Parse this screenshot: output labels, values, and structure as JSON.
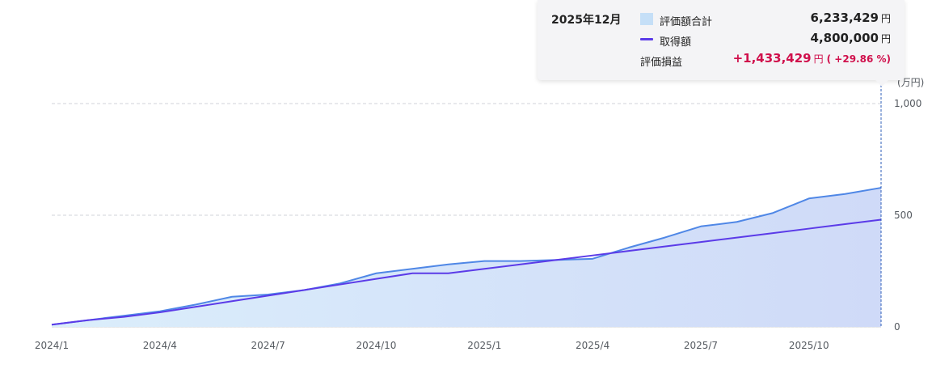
{
  "chart_data": {
    "type": "area",
    "x": [
      "2024/1",
      "2024/2",
      "2024/3",
      "2024/4",
      "2024/5",
      "2024/6",
      "2024/7",
      "2024/8",
      "2024/9",
      "2024/10",
      "2024/11",
      "2024/12",
      "2025/1",
      "2025/2",
      "2025/3",
      "2025/4",
      "2025/5",
      "2025/6",
      "2025/7",
      "2025/8",
      "2025/9",
      "2025/10",
      "2025/11",
      "2025/12"
    ],
    "x_tick_labels": [
      "2024/1",
      "2024/4",
      "2024/7",
      "2024/10",
      "2025/1",
      "2025/4",
      "2025/7",
      "2025/10"
    ],
    "series": [
      {
        "name": "評価額合計",
        "kind": "area",
        "color": "#4f87e6",
        "values": [
          10,
          30,
          50,
          70,
          100,
          135,
          145,
          165,
          195,
          240,
          260,
          280,
          295,
          295,
          300,
          305,
          355,
          400,
          450,
          470,
          510,
          575,
          595,
          623
        ]
      },
      {
        "name": "取得額",
        "kind": "line",
        "color": "#5b3be8",
        "values": [
          10,
          30,
          45,
          65,
          90,
          115,
          140,
          165,
          190,
          215,
          240,
          240,
          260,
          280,
          300,
          320,
          340,
          360,
          380,
          400,
          420,
          440,
          460,
          480
        ]
      }
    ],
    "unit": "(万円)",
    "ylim": [
      0,
      1000
    ],
    "y_ticks": [
      0,
      500,
      1000
    ],
    "y_tick_labels": [
      "0",
      "500",
      "1,000"
    ],
    "grid": true,
    "y_axis_side": "right"
  },
  "tooltip": {
    "month": "2025年12月",
    "rows": [
      {
        "label": "評価額合計",
        "value": "6,233,429",
        "yen": "円",
        "swatch": "fill"
      },
      {
        "label": "取得額",
        "value": "4,800,000",
        "yen": "円",
        "swatch": "line"
      },
      {
        "label": "評価損益",
        "value": "+1,433,429",
        "yen": "円",
        "pct": "( +29.86 %)",
        "swatch": "none"
      }
    ],
    "colors": {
      "positive": "#d0104c",
      "fill_swatch": "#c5dff7",
      "line_swatch": "#5b3be8"
    }
  }
}
